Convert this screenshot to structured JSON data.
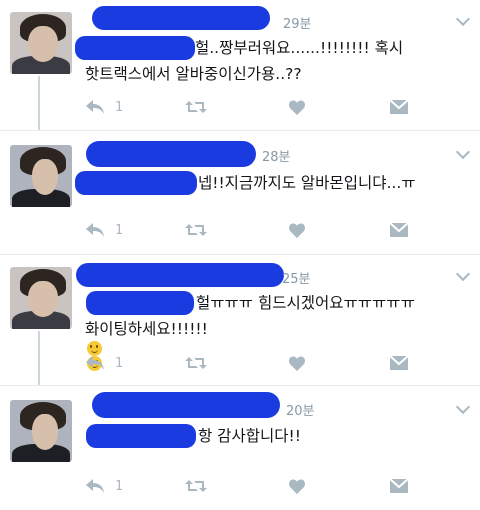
{
  "tweets": [
    {
      "time": "29분",
      "lines": [
        "헐..짱부러워요......!!!!!!!! 혹시",
        "핫트랙스에서 알바중이신가용..??"
      ],
      "emoji": false,
      "reply_count": "1",
      "accent": "#1a3be0"
    },
    {
      "time": "28분",
      "lines": [
        "넵!!지금까지도 알바몬입니댜...ㅠ"
      ],
      "emoji": false,
      "reply_count": "1"
    },
    {
      "time": "25분",
      "lines": [
        "헐ㅠㅠㅠ 힘드시겠어요ㅠㅠㅠㅠㅠ",
        "화이팅하세요!!!!!!"
      ],
      "emoji": true,
      "reply_count": "1"
    },
    {
      "time": "20분",
      "lines": [
        "항 감사합니다!!"
      ],
      "emoji": false,
      "reply_count": "1"
    }
  ],
  "icons": [
    "reply-icon",
    "retweet-icon",
    "like-icon",
    "message-icon",
    "chevron-down-icon"
  ],
  "colors": {
    "redaction": "#1a3be0",
    "icon": "#aab8c2",
    "time": "#8899a6",
    "divider": "#e6ecf0"
  }
}
